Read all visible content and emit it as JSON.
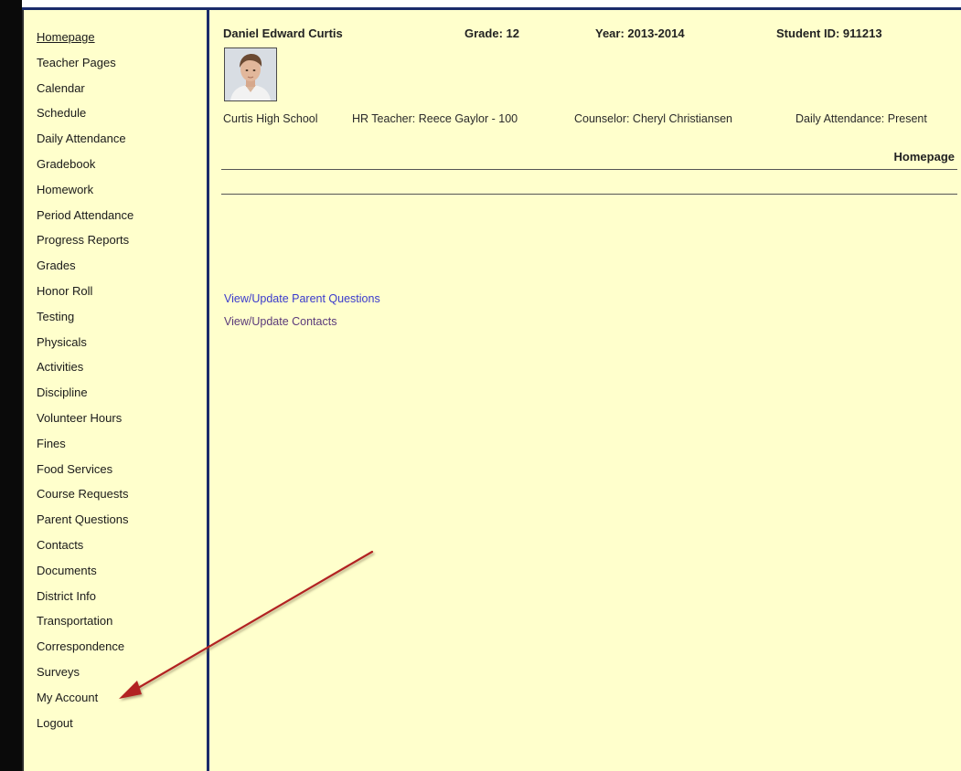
{
  "sidebar": {
    "items": [
      {
        "label": "Homepage"
      },
      {
        "label": "Teacher Pages"
      },
      {
        "label": "Calendar"
      },
      {
        "label": "Schedule"
      },
      {
        "label": "Daily Attendance"
      },
      {
        "label": "Gradebook"
      },
      {
        "label": "Homework"
      },
      {
        "label": "Period Attendance"
      },
      {
        "label": "Progress Reports"
      },
      {
        "label": "Grades"
      },
      {
        "label": "Honor Roll"
      },
      {
        "label": "Testing"
      },
      {
        "label": "Physicals"
      },
      {
        "label": "Activities"
      },
      {
        "label": "Discipline"
      },
      {
        "label": "Volunteer Hours"
      },
      {
        "label": "Fines"
      },
      {
        "label": "Food Services"
      },
      {
        "label": "Course Requests"
      },
      {
        "label": "Parent Questions"
      },
      {
        "label": "Contacts"
      },
      {
        "label": "Documents"
      },
      {
        "label": "District Info"
      },
      {
        "label": "Transportation"
      },
      {
        "label": "Correspondence"
      },
      {
        "label": "Surveys"
      },
      {
        "label": "My Account"
      },
      {
        "label": "Logout"
      }
    ]
  },
  "header": {
    "student_name": "Daniel Edward Curtis",
    "grade": "Grade: 12",
    "year": "Year: 2013-2014",
    "student_id": "Student ID: 911213"
  },
  "info": {
    "school": "Curtis High School",
    "hr_teacher": "HR Teacher: Reece Gaylor - 100",
    "counselor": "Counselor: Cheryl Christiansen",
    "attendance": "Daily Attendance: Present"
  },
  "page": {
    "heading": "Homepage"
  },
  "links": {
    "parent_questions": "View/Update Parent Questions",
    "contacts": "View/Update Contacts"
  },
  "colors": {
    "background": "#ffffcc",
    "divider": "#1a2b6b",
    "link": "#3a3acc",
    "arrow": "#b22222"
  },
  "icons": {
    "student_photo": "avatar",
    "annotation": "red-arrow-icon"
  }
}
